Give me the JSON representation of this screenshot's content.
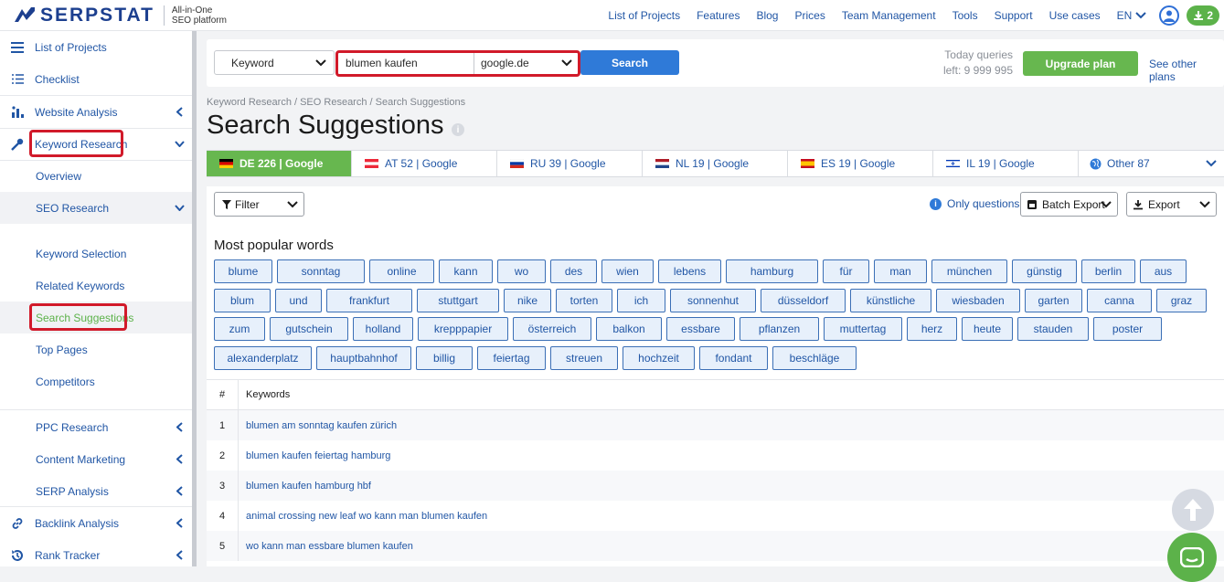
{
  "brand": {
    "name": "SERPSTAT",
    "tagline_1": "All-in-One",
    "tagline_2": "SEO platform"
  },
  "topnav": {
    "links": [
      "List of Projects",
      "Features",
      "Blog",
      "Prices",
      "Team Management",
      "Tools",
      "Support",
      "Use cases"
    ],
    "lang": "EN",
    "downloads_count": "2"
  },
  "sidebar": {
    "list_of_projects": "List of Projects",
    "checklist": "Checklist",
    "website_analysis": "Website Analysis",
    "keyword_research": "Keyword Research",
    "overview": "Overview",
    "seo_research": "SEO Research",
    "keyword_selection": "Keyword Selection",
    "related_keywords": "Related Keywords",
    "search_suggestions": "Search Suggestions",
    "top_pages": "Top Pages",
    "competitors": "Competitors",
    "ppc_research": "PPC Research",
    "content_marketing": "Content Marketing",
    "serp_analysis": "SERP Analysis",
    "backlink_analysis": "Backlink Analysis",
    "rank_tracker": "Rank Tracker"
  },
  "search": {
    "type": "Keyword",
    "query": "blumen kaufen",
    "database": "google.de",
    "button": "Search",
    "queries_line1": "Today queries",
    "queries_line2": "left: 9 999 995",
    "upgrade": "Upgrade plan",
    "other_plans": "See other plans"
  },
  "breadcrumb": "Keyword Research / SEO Research / Search Suggestions",
  "title": "Search Suggestions",
  "db_tabs": [
    {
      "label": "DE 226 | Google",
      "flag": "de"
    },
    {
      "label": "AT 52 | Google",
      "flag": "at"
    },
    {
      "label": "RU 39 | Google",
      "flag": "ru"
    },
    {
      "label": "NL 19 | Google",
      "flag": "nl"
    },
    {
      "label": "ES 19 | Google",
      "flag": "es"
    },
    {
      "label": "IL 19 | Google",
      "flag": "il"
    }
  ],
  "other_tab": "Other 87",
  "toolbar": {
    "filter": "Filter",
    "only_questions": "Only questions",
    "batch_export": "Batch Export",
    "export": "Export"
  },
  "popular_title": "Most popular words",
  "popular_words": [
    [
      "blume",
      "sonntag",
      "online",
      "kann",
      "wo",
      "des",
      "wien",
      "lebens",
      "hamburg",
      "für",
      "man",
      "münchen",
      "günstig",
      "berlin",
      "aus"
    ],
    [
      "blum",
      "und",
      "frankfurt",
      "stuttgart",
      "nike",
      "torten",
      "ich",
      "sonnenhut",
      "düsseldorf",
      "künstliche",
      "wiesbaden",
      "garten",
      "canna",
      "graz"
    ],
    [
      "zum",
      "gutschein",
      "holland",
      "krepppapier",
      "österreich",
      "balkon",
      "essbare",
      "pflanzen",
      "muttertag",
      "herz",
      "heute",
      "stauden",
      "poster"
    ],
    [
      "alexanderplatz",
      "hauptbahnhof",
      "billig",
      "feiertag",
      "streuen",
      "hochzeit",
      "fondant",
      "beschläge"
    ]
  ],
  "table": {
    "col_num": "#",
    "col_kw": "Keywords",
    "rows": [
      {
        "n": "1",
        "kw": "blumen am sonntag kaufen zürich"
      },
      {
        "n": "2",
        "kw": "blumen kaufen feiertag hamburg"
      },
      {
        "n": "3",
        "kw": "blumen kaufen hamburg hbf"
      },
      {
        "n": "4",
        "kw": "animal crossing new leaf wo kann man blumen kaufen"
      },
      {
        "n": "5",
        "kw": "wo kann man essbare blumen kaufen"
      }
    ]
  },
  "colors": {
    "accent_blue": "#2f7ad8",
    "accent_green": "#67b74f",
    "highlight_red": "#d11a2a",
    "link": "#2156a5"
  }
}
